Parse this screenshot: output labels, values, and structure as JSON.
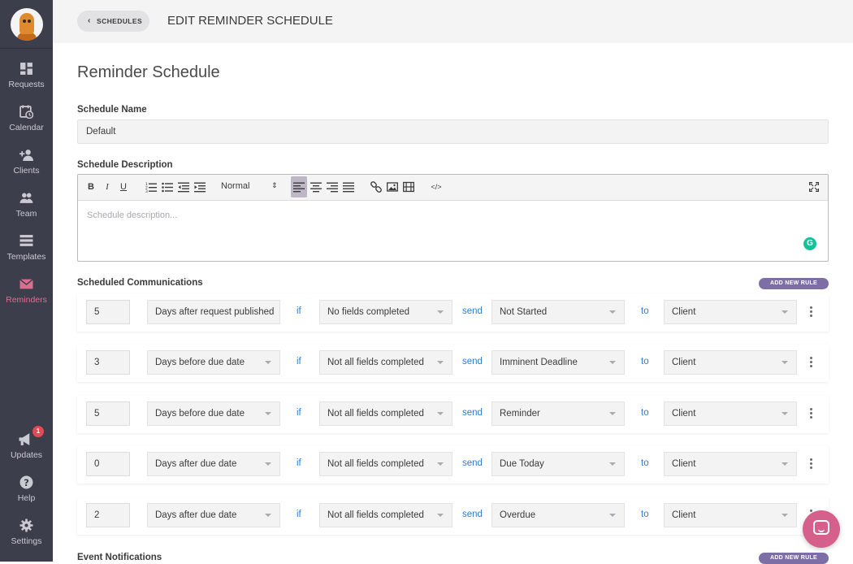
{
  "sidebar": {
    "items": [
      {
        "label": "Requests",
        "icon": "dashboard-icon"
      },
      {
        "label": "Calendar",
        "icon": "calendar-clock-icon"
      },
      {
        "label": "Clients",
        "icon": "add-user-icon"
      },
      {
        "label": "Team",
        "icon": "team-icon"
      },
      {
        "label": "Templates",
        "icon": "templates-icon"
      },
      {
        "label": "Reminders",
        "icon": "envelope-icon",
        "active": true
      }
    ],
    "bottom": [
      {
        "label": "Updates",
        "icon": "megaphone-icon",
        "badge": "1"
      },
      {
        "label": "Help",
        "icon": "help-icon"
      },
      {
        "label": "Settings",
        "icon": "gear-icon"
      }
    ]
  },
  "header": {
    "back_label": "SCHEDULES",
    "title": "EDIT REMINDER SCHEDULE"
  },
  "main": {
    "heading": "Reminder Schedule",
    "name_label": "Schedule Name",
    "name_value": "Default",
    "desc_label": "Schedule Description",
    "desc_placeholder": "Schedule description...",
    "format_value": "Normal",
    "comms_label": "Scheduled Communications",
    "add_rule_label": "ADD NEW RULE",
    "events_label": "Event Notifications",
    "keywords": {
      "if": "if",
      "send": "send",
      "to": "to"
    },
    "rules": [
      {
        "num": "5",
        "when": "Days after request published",
        "cond": "No fields completed",
        "msg": "Not Started",
        "to": "Client"
      },
      {
        "num": "3",
        "when": "Days before due date",
        "cond": "Not all fields completed",
        "msg": "Imminent Deadline",
        "to": "Client"
      },
      {
        "num": "5",
        "when": "Days before due date",
        "cond": "Not all fields completed",
        "msg": "Reminder",
        "to": "Client"
      },
      {
        "num": "0",
        "when": "Days after due date",
        "cond": "Not all fields completed",
        "msg": "Due Today",
        "to": "Client"
      },
      {
        "num": "2",
        "when": "Days after due date",
        "cond": "Not all fields completed",
        "msg": "Overdue",
        "to": "Client"
      }
    ]
  },
  "colors": {
    "sidebar": "#3c3e4c",
    "accent_active": "#d9708f",
    "link_blue": "#2e7bd0",
    "purple_button": "#7d6fa6",
    "chat": "#d5608b"
  }
}
